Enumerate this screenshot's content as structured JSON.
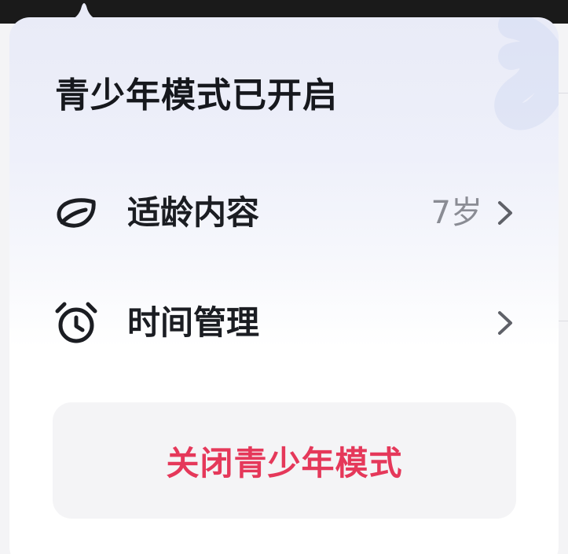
{
  "popover": {
    "title": "青少年模式已开启",
    "items": [
      {
        "label": "适龄内容",
        "value": "7岁",
        "icon": "leaf-icon",
        "chevron": "chevron-right-icon"
      },
      {
        "label": "时间管理",
        "value": "",
        "icon": "alarm-clock-icon",
        "chevron": "chevron-right-icon"
      }
    ],
    "close_button": {
      "label": "关闭青少年模式"
    }
  },
  "colors": {
    "title_text": "#16181d",
    "item_text": "#1b1d22",
    "value_text": "#8a8c94",
    "danger": "#e5385a",
    "button_bg": "#f4f4f6",
    "gradient_top": "#e9ebf7"
  }
}
